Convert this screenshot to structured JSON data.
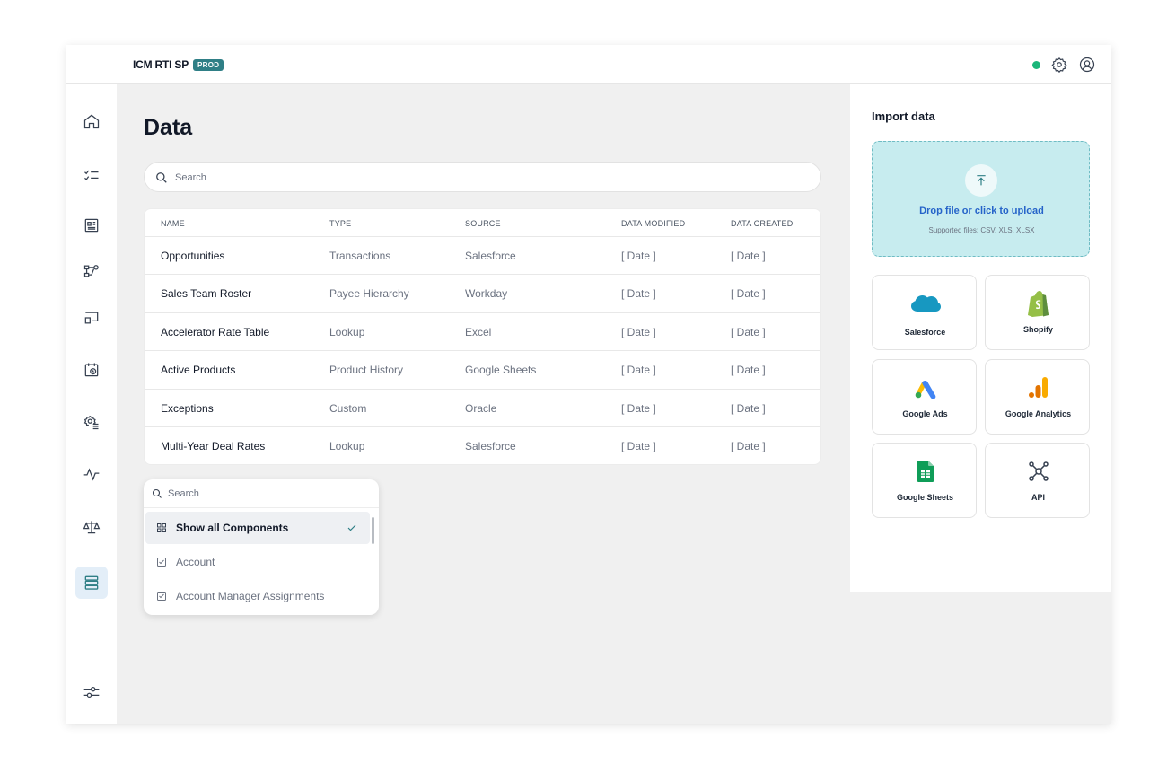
{
  "header": {
    "app_title": "ICM RTI SP",
    "env_badge": "PROD",
    "status_color": "#1bb67a",
    "icons": [
      "gear-icon",
      "user-circle-icon"
    ]
  },
  "sidebar": {
    "items": [
      {
        "icon": "home-icon",
        "active": false
      },
      {
        "icon": "checklist-icon",
        "active": false
      },
      {
        "icon": "dashboard-icon",
        "active": false
      },
      {
        "icon": "workflow-icon",
        "active": false
      },
      {
        "icon": "presentation-icon",
        "active": false
      },
      {
        "icon": "calendar-clock-icon",
        "active": false
      },
      {
        "icon": "settings-list-icon",
        "active": false
      },
      {
        "icon": "activity-icon",
        "active": false
      },
      {
        "icon": "scale-icon",
        "active": false
      },
      {
        "icon": "database-icon",
        "active": true
      }
    ],
    "footer_icon": "sliders-icon"
  },
  "main": {
    "title": "Data",
    "search_placeholder": "Search",
    "table": {
      "headers": [
        "NAME",
        "TYPE",
        "SOURCE",
        "DATA MODIFIED",
        "DATA CREATED"
      ],
      "rows": [
        [
          "Opportunities",
          "Transactions",
          "Salesforce",
          "[ Date ]",
          "[ Date ]"
        ],
        [
          "Sales Team Roster",
          "Payee Hierarchy",
          "Workday",
          "[ Date ]",
          "[ Date ]"
        ],
        [
          "Accelerator Rate Table",
          "Lookup",
          "Excel",
          "[ Date ]",
          "[ Date ]"
        ],
        [
          "Active Products",
          "Product History",
          "Google Sheets",
          "[ Date ]",
          "[ Date ]"
        ],
        [
          "Exceptions",
          "Custom",
          "Oracle",
          "[ Date ]",
          "[ Date ]"
        ],
        [
          "Multi-Year Deal Rates",
          "Lookup",
          "Salesforce",
          "[ Date ]",
          "[ Date ]"
        ]
      ]
    },
    "dropdown": {
      "search_placeholder": "Search",
      "items": [
        {
          "label": "Show all Components",
          "icon": "grid-icon",
          "selected": true
        },
        {
          "label": "Account",
          "icon": "checkbox-icon",
          "selected": false
        },
        {
          "label": "Account Manager Assignments",
          "icon": "checkbox-icon",
          "selected": false
        }
      ]
    }
  },
  "import": {
    "title": "Import data",
    "drop_title": "Drop file or click to upload",
    "drop_sub": "Supported files: CSV, XLS, XLSX",
    "sources": [
      {
        "label": "Salesforce",
        "icon": "salesforce-icon"
      },
      {
        "label": "Shopify",
        "icon": "shopify-icon"
      },
      {
        "label": "Google Ads",
        "icon": "google-ads-icon"
      },
      {
        "label": "Google Analytics",
        "icon": "google-analytics-icon"
      },
      {
        "label": "Google Sheets",
        "icon": "google-sheets-icon"
      },
      {
        "label": "API",
        "icon": "api-icon"
      }
    ]
  },
  "colors": {
    "accent": "#2f7f86",
    "link": "#2563c9",
    "dropzone": "#c7ecef"
  }
}
